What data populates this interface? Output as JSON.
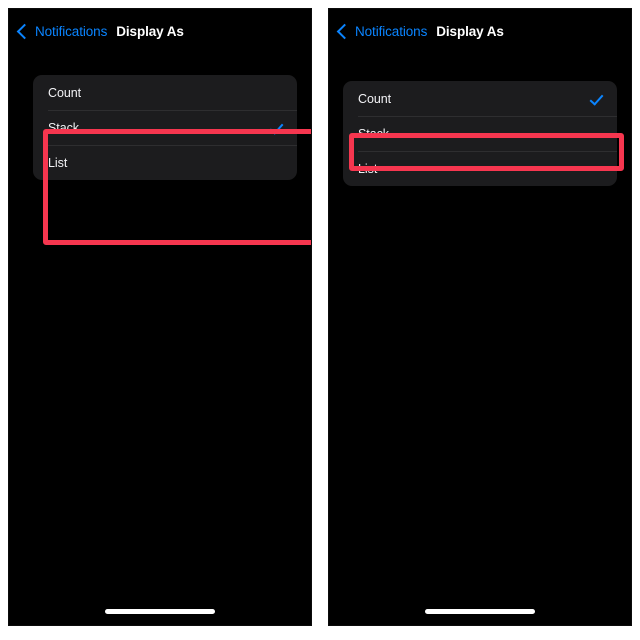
{
  "meta": {
    "page_background": "#ffffff",
    "screen_background": "#000000",
    "group_background": "#1c1c1e",
    "accent_blue": "#0a84ff",
    "annotation_red": "#f6364f"
  },
  "panels": [
    {
      "id": "left",
      "navbar": {
        "back_label": "Notifications",
        "back_icon": "chevron-left-icon",
        "title": "Display As"
      },
      "options": [
        {
          "label": "Count",
          "selected": false
        },
        {
          "label": "Stack",
          "selected": true
        },
        {
          "label": "List",
          "selected": false
        }
      ],
      "annotation": {
        "target": "whole-option-group"
      }
    },
    {
      "id": "right",
      "navbar": {
        "back_label": "Notifications",
        "back_icon": "chevron-left-icon",
        "title": "Display As"
      },
      "options": [
        {
          "label": "Count",
          "selected": true
        },
        {
          "label": "Stack",
          "selected": false
        },
        {
          "label": "List",
          "selected": false
        }
      ],
      "annotation": {
        "target": "count-row"
      }
    }
  ]
}
